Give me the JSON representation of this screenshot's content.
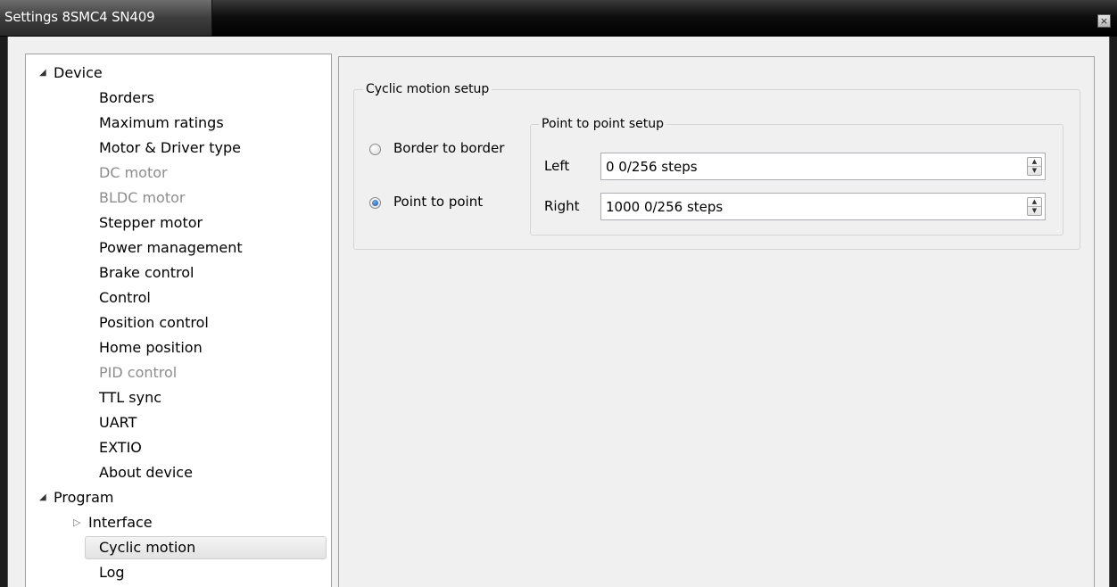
{
  "window": {
    "title": "Settings 8SMC4 SN409",
    "close_glyph": "×"
  },
  "tree": {
    "device": {
      "label": "Device",
      "items": [
        {
          "label": "Borders",
          "enabled": true
        },
        {
          "label": "Maximum ratings",
          "enabled": true
        },
        {
          "label": "Motor & Driver type",
          "enabled": true
        },
        {
          "label": "DC motor",
          "enabled": false
        },
        {
          "label": "BLDC motor",
          "enabled": false
        },
        {
          "label": "Stepper motor",
          "enabled": true
        },
        {
          "label": "Power management",
          "enabled": true
        },
        {
          "label": "Brake control",
          "enabled": true
        },
        {
          "label": "Control",
          "enabled": true
        },
        {
          "label": "Position control",
          "enabled": true
        },
        {
          "label": "Home position",
          "enabled": true
        },
        {
          "label": "PID control",
          "enabled": false
        },
        {
          "label": "TTL sync",
          "enabled": true
        },
        {
          "label": "UART",
          "enabled": true
        },
        {
          "label": "EXTIO",
          "enabled": true
        },
        {
          "label": "About device",
          "enabled": true
        }
      ]
    },
    "program": {
      "label": "Program",
      "items": [
        {
          "label": "Interface",
          "has_children": true
        },
        {
          "label": "Cyclic motion",
          "selected": true
        },
        {
          "label": "Log"
        }
      ]
    }
  },
  "cyclic": {
    "group_title": "Cyclic motion setup",
    "radio_border_label": "Border to border",
    "radio_point_label": "Point to point",
    "selected": "point_to_point",
    "p2p": {
      "group_title": "Point to point setup",
      "left_label": "Left",
      "left_value": "0 0/256 steps",
      "right_label": "Right",
      "right_value": "1000 0/256 steps"
    }
  },
  "icons": {
    "expanded": "◢",
    "collapsed": "▷",
    "spin_up": "▲",
    "spin_down": "▼"
  }
}
